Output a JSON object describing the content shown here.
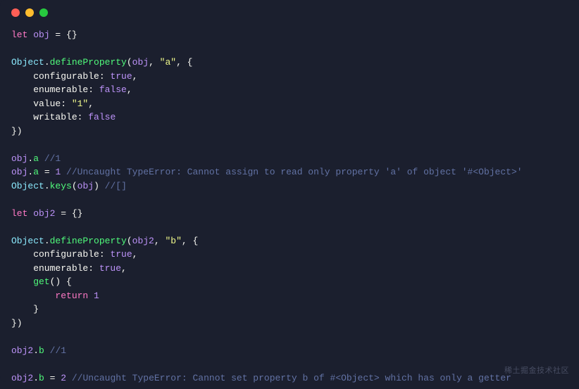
{
  "titlebar": {
    "dots": [
      "red",
      "yellow",
      "green"
    ]
  },
  "code": {
    "l1_let": "let",
    "l1_obj": "obj",
    "l1_eq": " = {}",
    "l2_obj": "Object",
    "l2_dot1": ".",
    "l2_method": "defineProperty",
    "l2_open": "(",
    "l2_arg1": "obj",
    "l2_comma1": ", ",
    "l2_arg2": "\"a\"",
    "l2_comma2": ", {",
    "l3_key": "    configurable",
    "l3_colon": ": ",
    "l3_val": "true",
    "l3_comma": ",",
    "l4_key": "    enumerable",
    "l4_colon": ": ",
    "l4_val": "false",
    "l4_comma": ",",
    "l5_key": "    value",
    "l5_colon": ": ",
    "l5_val": "\"1\"",
    "l5_comma": ",",
    "l6_key": "    writable",
    "l6_colon": ": ",
    "l6_val": "false",
    "l7_close": "})",
    "l8_obj": "obj",
    "l8_dot": ".",
    "l8_prop": "a",
    "l8_comment": " //1",
    "l9_obj": "obj",
    "l9_dot": ".",
    "l9_prop": "a",
    "l9_eq": " = ",
    "l9_val": "1",
    "l9_comment": " //Uncaught TypeError: Cannot assign to read only property 'a' of object '#<Object>'",
    "l10_obj": "Object",
    "l10_dot": ".",
    "l10_method": "keys",
    "l10_open": "(",
    "l10_arg": "obj",
    "l10_close": ")",
    "l10_comment": " //[]",
    "l11_let": "let",
    "l11_obj": " obj2",
    "l11_eq": " = {}",
    "l12_obj": "Object",
    "l12_dot": ".",
    "l12_method": "defineProperty",
    "l12_open": "(",
    "l12_arg1": "obj2",
    "l12_comma1": ", ",
    "l12_arg2": "\"b\"",
    "l12_comma2": ", {",
    "l13_key": "    configurable",
    "l13_colon": ": ",
    "l13_val": "true",
    "l13_comma": ",",
    "l14_key": "    enumerable",
    "l14_colon": ": ",
    "l14_val": "true",
    "l14_comma": ",",
    "l15_get": "    get",
    "l15_paren": "() {",
    "l16_return": "        return",
    "l16_val": " 1",
    "l17_close": "    }",
    "l18_close": "})",
    "l19_obj": "obj2",
    "l19_dot": ".",
    "l19_prop": "b",
    "l19_comment": " //1",
    "l20_obj": "obj2",
    "l20_dot": ".",
    "l20_prop": "b",
    "l20_eq": " = ",
    "l20_val": "2",
    "l20_comment": " //Uncaught TypeError: Cannot set property b of #<Object> which has only a getter"
  },
  "watermark": "稀土掘金技术社区"
}
